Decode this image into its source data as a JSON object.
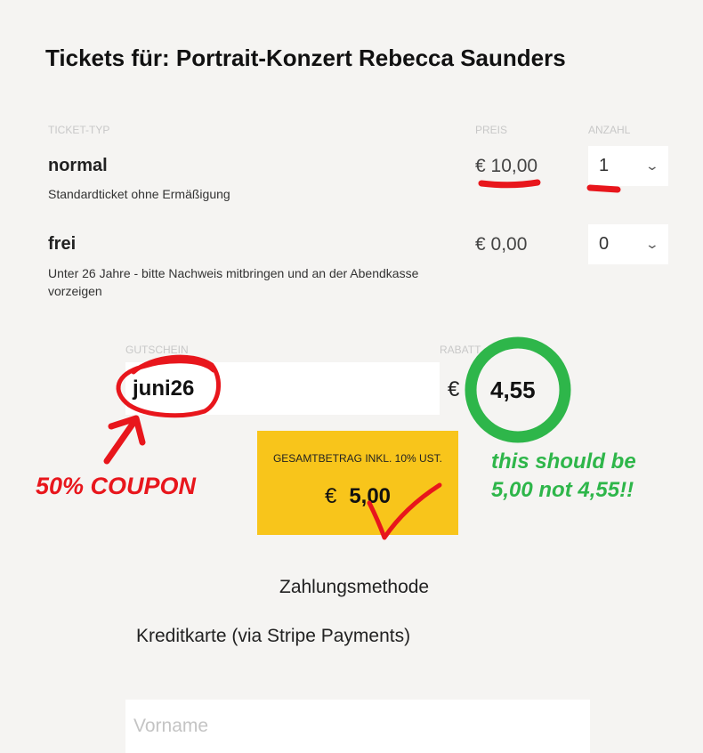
{
  "page": {
    "title": "Tickets für: Portrait-Konzert Rebecca Saunders"
  },
  "table": {
    "headers": {
      "type": "TICKET-TYP",
      "price": "PREIS",
      "qty": "ANZAHL"
    },
    "rows": [
      {
        "name": "normal",
        "desc": "Standardticket ohne Ermäßigung",
        "currency": "€",
        "price": "10,00",
        "qty": "1"
      },
      {
        "name": "frei",
        "desc": "Unter 26 Jahre - bitte Nachweis mitbringen und an der Abendkasse vorzeigen",
        "currency": "€",
        "price": "0,00",
        "qty": "0"
      }
    ]
  },
  "voucher": {
    "label": "GUTSCHEIN",
    "value": "juni26",
    "discount_label": "RABATT",
    "currency": "€",
    "discount_value": "4,55"
  },
  "total": {
    "label": "GESAMTBETRAG INKL. 10% UST.",
    "currency": "€",
    "value": "5,00"
  },
  "payment": {
    "heading": "Zahlungsmethode",
    "method": "Kreditkarte (via Stripe Payments)"
  },
  "form": {
    "firstname_placeholder": "Vorname"
  },
  "annotations": {
    "coupon_note": "50% COUPON",
    "discount_note_line1": "this should be",
    "discount_note_line2": "5,00 not 4,55!!",
    "red": "#e8161c",
    "green": "#2eb64a",
    "accent_yellow": "#f8c51b"
  }
}
